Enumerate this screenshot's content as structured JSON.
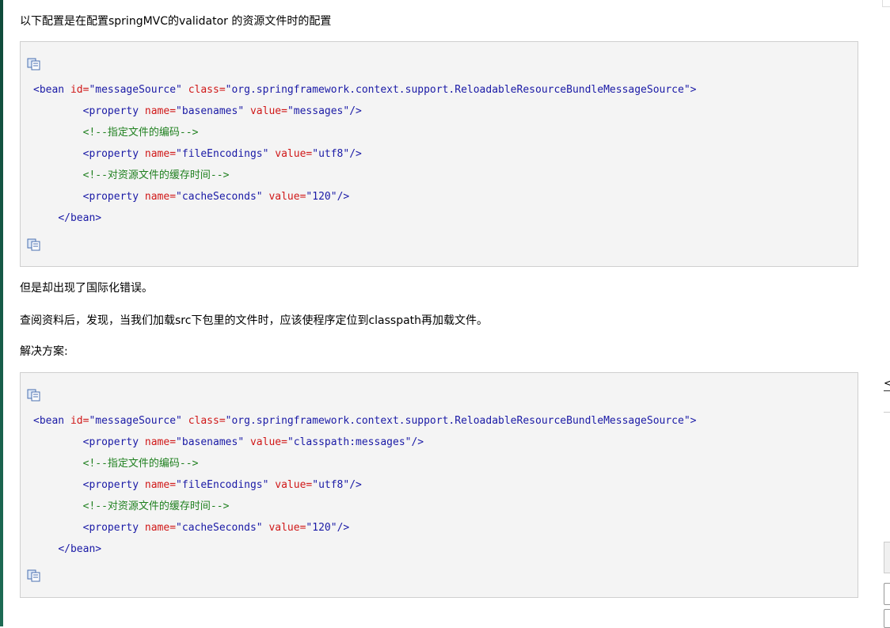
{
  "paragraphs": {
    "intro": "以下配置是在配置springMVC的validator 的资源文件时的配置",
    "error": "但是却出现了国际化错误。",
    "finding": "查阅资料后，发现，当我们加载src下包里的文件时，应该使程序定位到classpath再加载文件。",
    "solution": "解决方案:"
  },
  "code_blocks": [
    {
      "lines": {
        "open_tag": "<bean",
        "id_attr": "id=",
        "id_val": "\"messageSource\"",
        "class_attr": "class=",
        "class_val": "\"org.springframework.context.support.ReloadableResourceBundleMessageSource\"",
        "open_end": ">",
        "prop1_tag": "<property",
        "prop1_name_attr": "name=",
        "prop1_name_val": "\"basenames\"",
        "prop1_value_attr": "value=",
        "prop1_value_val": "\"messages\"",
        "prop1_end": "/>",
        "comment1": "<!--指定文件的编码-->",
        "prop2_tag": "<property",
        "prop2_name_attr": "name=",
        "prop2_name_val": "\"fileEncodings\"",
        "prop2_value_attr": "value=",
        "prop2_value_val": "\"utf8\"",
        "prop2_end": "/>",
        "comment2": "<!--对资源文件的缓存时间-->",
        "prop3_tag": "<property",
        "prop3_name_attr": "name=",
        "prop3_name_val": "\"cacheSeconds\"",
        "prop3_value_attr": "value=",
        "prop3_value_val": "\"120\"",
        "prop3_end": "/>",
        "close_tag": "</bean>"
      }
    },
    {
      "lines": {
        "open_tag": "<bean",
        "id_attr": "id=",
        "id_val": "\"messageSource\"",
        "class_attr": "class=",
        "class_val": "\"org.springframework.context.support.ReloadableResourceBundleMessageSource\"",
        "open_end": ">",
        "prop1_tag": "<property",
        "prop1_name_attr": "name=",
        "prop1_name_val": "\"basenames\"",
        "prop1_value_attr": "value=",
        "prop1_value_val": "\"classpath:messages\"",
        "prop1_end": "/>",
        "comment1": "<!--指定文件的编码-->",
        "prop2_tag": "<property",
        "prop2_name_attr": "name=",
        "prop2_name_val": "\"fileEncodings\"",
        "prop2_value_attr": "value=",
        "prop2_value_val": "\"utf8\"",
        "prop2_end": "/>",
        "comment2": "<!--对资源文件的缓存时间-->",
        "prop3_tag": "<property",
        "prop3_name_attr": "name=",
        "prop3_name_val": "\"cacheSeconds\"",
        "prop3_value_attr": "value=",
        "prop3_value_val": "\"120\"",
        "prop3_end": "/>",
        "close_tag": "</bean>"
      }
    }
  ],
  "icons": {
    "copy": "copy-code-icon"
  },
  "colors": {
    "tag": "#1a1aa6",
    "attr": "#d01818",
    "comment": "#208020",
    "code_bg": "#f4f4f4"
  }
}
